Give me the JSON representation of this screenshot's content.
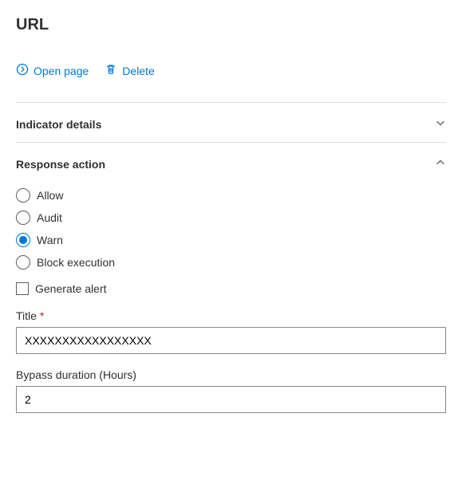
{
  "title": "URL",
  "actions": {
    "open_page": "Open page",
    "delete": "Delete"
  },
  "sections": {
    "details": {
      "title": "Indicator details",
      "expanded": false
    },
    "response": {
      "title": "Response action",
      "expanded": true
    }
  },
  "response": {
    "options": {
      "allow": "Allow",
      "audit": "Audit",
      "warn": "Warn",
      "block": "Block execution"
    },
    "selected": "warn",
    "generate_alert_label": "Generate alert",
    "generate_alert_checked": false,
    "title_label": "Title",
    "title_required": "*",
    "title_value": "XXXXXXXXXXXXXXXXX",
    "bypass_label": "Bypass duration (Hours)",
    "bypass_value": "2"
  }
}
